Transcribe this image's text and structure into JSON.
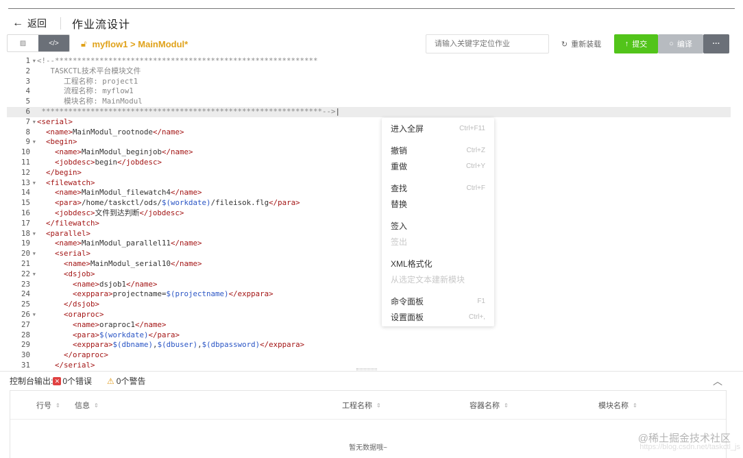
{
  "header": {
    "back_label": "返回",
    "back_icon": "arrow-left-icon",
    "title": "作业流设计"
  },
  "toolbar": {
    "view_toggle": [
      "▨",
      "</>"
    ],
    "breadcrumb": "myflow1 > MainModul*",
    "breadcrumb_icon": "lock-icon",
    "search_placeholder": "请输入关键字定位作业",
    "reload_label": "重新装载",
    "submit_label": "提交",
    "compile_label": "编译",
    "more_label": "···"
  },
  "editor": {
    "lines": [
      {
        "n": "1",
        "fold": true,
        "parts": [
          [
            "cmt",
            "<!--***********************************************************"
          ]
        ]
      },
      {
        "n": "2",
        "parts": [
          [
            "cmt",
            "   TASKCTL技术平台模块文件"
          ]
        ]
      },
      {
        "n": "3",
        "parts": [
          [
            "cmt",
            "      工程名称: project1"
          ]
        ]
      },
      {
        "n": "4",
        "parts": [
          [
            "cmt",
            "      流程名称: myflow1"
          ]
        ]
      },
      {
        "n": "5",
        "parts": [
          [
            "cmt",
            "      模块名称: MainModul"
          ]
        ]
      },
      {
        "n": "6",
        "hl": true,
        "parts": [
          [
            "cmt",
            " ***************************************************************-->"
          ],
          [
            "code",
            "|"
          ]
        ]
      },
      {
        "n": "7",
        "fold": true,
        "parts": [
          [
            "tag",
            "<serial>"
          ]
        ]
      },
      {
        "n": "8",
        "parts": [
          [
            "code",
            "  "
          ],
          [
            "tag",
            "<name>"
          ],
          [
            "code",
            "MainModul_rootnode"
          ],
          [
            "tag",
            "</name>"
          ]
        ]
      },
      {
        "n": "9",
        "fold": true,
        "parts": [
          [
            "code",
            "  "
          ],
          [
            "tag",
            "<begin>"
          ]
        ]
      },
      {
        "n": "10",
        "parts": [
          [
            "code",
            "    "
          ],
          [
            "tag",
            "<name>"
          ],
          [
            "code",
            "MainModul_beginjob"
          ],
          [
            "tag",
            "</name>"
          ]
        ]
      },
      {
        "n": "11",
        "parts": [
          [
            "code",
            "    "
          ],
          [
            "tag",
            "<jobdesc>"
          ],
          [
            "code",
            "begin"
          ],
          [
            "tag",
            "</jobdesc>"
          ]
        ]
      },
      {
        "n": "12",
        "parts": [
          [
            "code",
            "  "
          ],
          [
            "tag",
            "</begin>"
          ]
        ]
      },
      {
        "n": "13",
        "fold": true,
        "parts": [
          [
            "code",
            "  "
          ],
          [
            "tag",
            "<filewatch>"
          ]
        ]
      },
      {
        "n": "14",
        "parts": [
          [
            "code",
            "    "
          ],
          [
            "tag",
            "<name>"
          ],
          [
            "code",
            "MainModul_filewatch4"
          ],
          [
            "tag",
            "</name>"
          ]
        ]
      },
      {
        "n": "15",
        "parts": [
          [
            "code",
            "    "
          ],
          [
            "tag",
            "<para>"
          ],
          [
            "code",
            "/home/taskctl/ods/"
          ],
          [
            "var",
            "$(workdate)"
          ],
          [
            "code",
            "/fileisok.flg"
          ],
          [
            "tag",
            "</para>"
          ]
        ]
      },
      {
        "n": "16",
        "parts": [
          [
            "code",
            "    "
          ],
          [
            "tag",
            "<jobdesc>"
          ],
          [
            "code",
            "文件到达判断"
          ],
          [
            "tag",
            "</jobdesc>"
          ]
        ]
      },
      {
        "n": "17",
        "parts": [
          [
            "code",
            "  "
          ],
          [
            "tag",
            "</filewatch>"
          ]
        ]
      },
      {
        "n": "18",
        "fold": true,
        "parts": [
          [
            "code",
            "  "
          ],
          [
            "tag",
            "<parallel>"
          ]
        ]
      },
      {
        "n": "19",
        "parts": [
          [
            "code",
            "    "
          ],
          [
            "tag",
            "<name>"
          ],
          [
            "code",
            "MainModul_parallel11"
          ],
          [
            "tag",
            "</name>"
          ]
        ]
      },
      {
        "n": "20",
        "fold": true,
        "parts": [
          [
            "code",
            "    "
          ],
          [
            "tag",
            "<serial>"
          ]
        ]
      },
      {
        "n": "21",
        "parts": [
          [
            "code",
            "      "
          ],
          [
            "tag",
            "<name>"
          ],
          [
            "code",
            "MainModul_serial10"
          ],
          [
            "tag",
            "</name>"
          ]
        ]
      },
      {
        "n": "22",
        "fold": true,
        "parts": [
          [
            "code",
            "      "
          ],
          [
            "tag",
            "<dsjob>"
          ]
        ]
      },
      {
        "n": "23",
        "parts": [
          [
            "code",
            "        "
          ],
          [
            "tag",
            "<name>"
          ],
          [
            "code",
            "dsjob1"
          ],
          [
            "tag",
            "</name>"
          ]
        ]
      },
      {
        "n": "24",
        "parts": [
          [
            "code",
            "        "
          ],
          [
            "tag",
            "<exppara>"
          ],
          [
            "code",
            "projectname="
          ],
          [
            "var",
            "$(projectname)"
          ],
          [
            "tag",
            "</exppara>"
          ]
        ]
      },
      {
        "n": "25",
        "parts": [
          [
            "code",
            "      "
          ],
          [
            "tag",
            "</dsjob>"
          ]
        ]
      },
      {
        "n": "26",
        "fold": true,
        "parts": [
          [
            "code",
            "      "
          ],
          [
            "tag",
            "<oraproc>"
          ]
        ]
      },
      {
        "n": "27",
        "parts": [
          [
            "code",
            "        "
          ],
          [
            "tag",
            "<name>"
          ],
          [
            "code",
            "oraproc1"
          ],
          [
            "tag",
            "</name>"
          ]
        ]
      },
      {
        "n": "28",
        "parts": [
          [
            "code",
            "        "
          ],
          [
            "tag",
            "<para>"
          ],
          [
            "var",
            "$(workdate)"
          ],
          [
            "tag",
            "</para>"
          ]
        ]
      },
      {
        "n": "29",
        "parts": [
          [
            "code",
            "        "
          ],
          [
            "tag",
            "<exppara>"
          ],
          [
            "var",
            "$(dbname)"
          ],
          [
            "code",
            ","
          ],
          [
            "var",
            "$(dbuser)"
          ],
          [
            "code",
            ","
          ],
          [
            "var",
            "$(dbpassword)"
          ],
          [
            "tag",
            "</exppara>"
          ]
        ]
      },
      {
        "n": "30",
        "parts": [
          [
            "code",
            "      "
          ],
          [
            "tag",
            "</oraproc>"
          ]
        ]
      },
      {
        "n": "31",
        "parts": [
          [
            "code",
            "    "
          ],
          [
            "tag",
            "</serial>"
          ]
        ]
      }
    ]
  },
  "context_menu": {
    "groups": [
      [
        {
          "label": "进入全屏",
          "shortcut": "Ctrl+F11"
        }
      ],
      [
        {
          "label": "撤销",
          "shortcut": "Ctrl+Z"
        },
        {
          "label": "重做",
          "shortcut": "Ctrl+Y"
        }
      ],
      [
        {
          "label": "查找",
          "shortcut": "Ctrl+F"
        },
        {
          "label": "替换",
          "shortcut": ""
        }
      ],
      [
        {
          "label": "签入",
          "shortcut": ""
        },
        {
          "label": "签出",
          "shortcut": "",
          "disabled": true
        }
      ],
      [
        {
          "label": "XML格式化",
          "shortcut": ""
        },
        {
          "label": "从选定文本建新模块",
          "shortcut": "",
          "disabled": true
        }
      ],
      [
        {
          "label": "命令面板",
          "shortcut": "F1"
        },
        {
          "label": "设置面板",
          "shortcut": "Ctrl+,"
        }
      ]
    ]
  },
  "console": {
    "label": "控制台输出:",
    "errors": "0个错误",
    "warnings": "0个警告",
    "collapse_icon": "chevron-up-icon",
    "columns": [
      "行号",
      "信息",
      "工程名称",
      "容器名称",
      "模块名称"
    ],
    "empty_text": "暂无数据哦~"
  },
  "watermark": {
    "main": "@稀土掘金技术社区",
    "sub": "https://blog.csdn.net/taskctl_js"
  }
}
